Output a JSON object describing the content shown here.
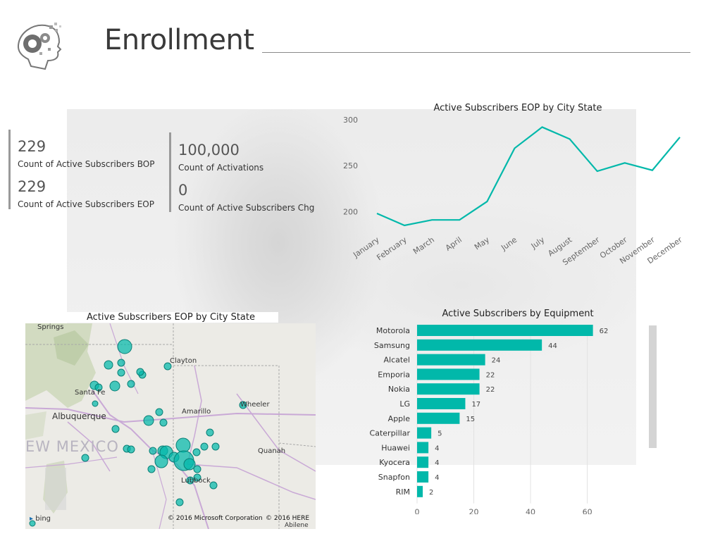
{
  "page": {
    "title": "Enrollment"
  },
  "kpis": [
    {
      "value": "229",
      "label": "Count of Active Subscribers BOP"
    },
    {
      "value": "229",
      "label": "Count of Active Subscribers EOP"
    },
    {
      "value": "100,000",
      "label": "Count of Activations"
    },
    {
      "value": "0",
      "label": "Count of Active Subscribers Chg"
    }
  ],
  "colors": {
    "accent": "#01B8AA",
    "text": "#333333"
  },
  "chart_data": [
    {
      "type": "line",
      "title": "Active Subscribers EOP by City State",
      "categories": [
        "January",
        "February",
        "March",
        "April",
        "May",
        "June",
        "July",
        "August",
        "September",
        "October",
        "November",
        "December"
      ],
      "values": [
        198,
        185,
        191,
        191,
        211,
        269,
        292,
        279,
        244,
        253,
        245,
        281
      ],
      "ylim": [
        185,
        300
      ],
      "yticks": [
        200,
        250,
        300
      ],
      "ytick_labels": [
        "200",
        "250",
        "300"
      ],
      "grid": false
    },
    {
      "type": "bar",
      "orientation": "horizontal",
      "title": "Active Subscribers by Equipment",
      "categories": [
        "Motorola",
        "Samsung",
        "Alcatel",
        "Emporia",
        "Nokia",
        "LG",
        "Apple",
        "Caterpillar",
        "Huawei",
        "Kyocera",
        "Snapfon",
        "RIM"
      ],
      "values": [
        62,
        44,
        24,
        22,
        22,
        17,
        15,
        5,
        4,
        4,
        4,
        2
      ],
      "xlim": [
        0,
        76
      ],
      "xticks": [
        0,
        20,
        40,
        60
      ],
      "xtick_labels": [
        "0",
        "20",
        "40",
        "60"
      ],
      "data_labels": true,
      "grid": true
    }
  ],
  "map": {
    "title": "Active Subscribers EOP by City State",
    "state_label": "EW MEXICO",
    "cities": [
      "Springs",
      "Clayton",
      "Santa Fe",
      "Albuquerque",
      "Amarillo",
      "Wheeler",
      "Quanah",
      "Lubbock",
      "Abilene"
    ],
    "credit_1": "© 2016 Microsoft Corporation",
    "credit_2": "© 2016 HERE",
    "logo": "bing"
  }
}
